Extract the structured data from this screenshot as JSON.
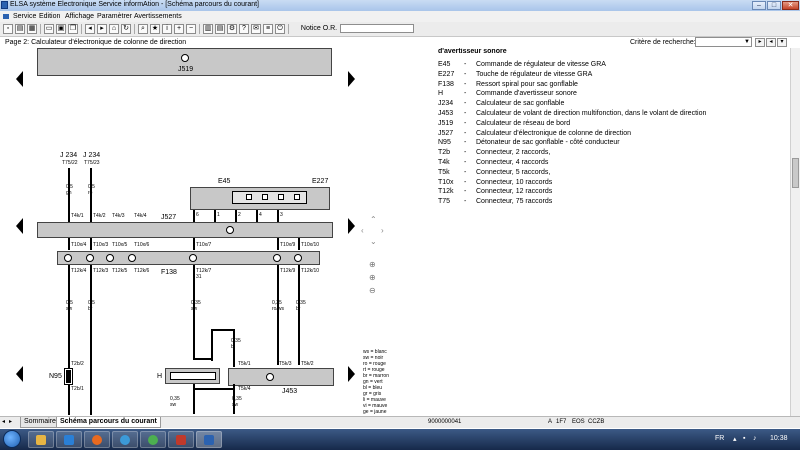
{
  "window": {
    "title": "ELSA système Electronique Service informAtion - [Schéma parcours du courant]",
    "minimize": "–",
    "maximize": "□",
    "close": "✕"
  },
  "menu": {
    "items": [
      "Service",
      "Edition",
      "Affichage",
      "Paramètrer",
      "Avertissements"
    ]
  },
  "toolbar": {
    "notice_label": "Notice O.R.",
    "notice_value": ""
  },
  "pagebar": {
    "title": "Page 2: Calculateur d'électronique de colonne de direction",
    "criteria_label": "Critère de recherche:",
    "criteria_value": ""
  },
  "diagram": {
    "j519": "J519",
    "j234_a": "J 234",
    "j234_a_pin": "T75/22",
    "j234_b": "J 234",
    "j234_b_pin": "T75/23",
    "e45": "E45",
    "e227": "E227",
    "j527": "J527",
    "f138": "F138",
    "n95": "N95",
    "h": "H",
    "j453": "J453",
    "wire_05_gn": "0,5\ngn",
    "wire_05_ro": "0,5\nro",
    "conn_labels_top": [
      "T4k/1",
      "T4k/2",
      "T4k/3",
      "T4k/4"
    ],
    "conn_labels_mid": [
      "T10x/4",
      "T10x/3",
      "T10x/5",
      "T10x/6",
      "T10x/7",
      "T10x/9",
      "T10x/10"
    ],
    "conn_labels_bot": [
      "T12k/4",
      "T12k/3",
      "T12k/5",
      "T12k/6",
      "T12k/7",
      "T12k/9",
      "T12k/10"
    ],
    "e_pins": [
      "6",
      "1",
      "2",
      "4",
      "3"
    ],
    "wire_low_1": "0,5\nsw",
    "wire_low_2": "0,5\nbr",
    "wire_low_3": "0,35\nsw",
    "wire_low_4": "0,35\nro/ws",
    "wire_low_5": "0,35\nbr",
    "wire_bl": "0,35\nbl",
    "wire_sw1": "0,35\nsw",
    "wire_sw2": "0,35\nsw",
    "t2b2": "T2b/2",
    "t2b1": "T2b/1",
    "t5k1": "T5k/1",
    "t5k3": "T5k/3",
    "t5k2": "T5k/2",
    "t5k4": "T5k/4",
    "pin31a": "31",
    "colors": [
      "ws = blanc",
      "sw = noir",
      "ro = rouge",
      "rt = rouge",
      "br = marron",
      "gn = vert",
      "bl = bleu",
      "gr = gris",
      "li = mauve",
      "vi = mauve",
      "ge = jaune"
    ]
  },
  "legend": {
    "heading": "d'avertisseur sonore",
    "rows": [
      {
        "code": "E45",
        "desc": "Commande de régulateur de vitesse GRA"
      },
      {
        "code": "E227",
        "desc": "Touche de régulateur de vitesse GRA"
      },
      {
        "code": "F138",
        "desc": "Ressort spiral pour sac gonflable"
      },
      {
        "code": "H",
        "desc": "Commande d'avertisseur sonore"
      },
      {
        "code": "J234",
        "desc": "Calculateur de sac gonflable"
      },
      {
        "code": "J453",
        "desc": "Calculateur de volant de direction multifonction, dans le volant de direction"
      },
      {
        "code": "J519",
        "desc": "Calculateur de réseau de bord"
      },
      {
        "code": "J527",
        "desc": "Calculateur d'électronique de colonne de direction"
      },
      {
        "code": "N95",
        "desc": "Détonateur de sac gonflable - côté conducteur"
      },
      {
        "code": "T2b",
        "desc": "Connecteur, 2 raccords,"
      },
      {
        "code": "T4k",
        "desc": "Connecteur, 4 raccords"
      },
      {
        "code": "T5k",
        "desc": "Connecteur, 5 raccords,"
      },
      {
        "code": "T10x",
        "desc": "Connecteur, 10 raccords"
      },
      {
        "code": "T12k",
        "desc": "Connecteur, 12 raccords"
      },
      {
        "code": "T75",
        "desc": "Connecteur, 75 raccords"
      }
    ],
    "dash": "-"
  },
  "tabs": [
    "Sommaire",
    "Schéma parcours du courant"
  ],
  "status": {
    "code": "9000000041",
    "a": "A",
    "v1": "1F7",
    "v2": "EOS",
    "v3": "CCZB"
  },
  "taskbar": {
    "lang": "FR",
    "clock": "10:38"
  }
}
